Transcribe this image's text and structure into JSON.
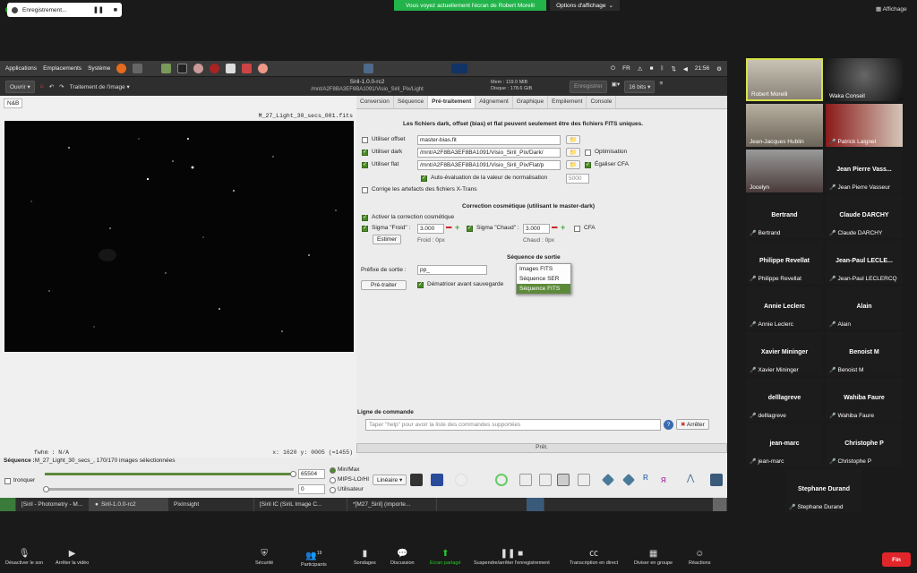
{
  "zoom_top": {
    "recording_label": "Enregistrement...",
    "share_banner": "Vous voyez actuellement l'écran de Robert Morelli",
    "view_options": "Options d'affichage",
    "display": "Affichage"
  },
  "desktop_bar": {
    "applications": "Applications",
    "places": "Emplacements",
    "system": "Système",
    "keyboard": "FR",
    "clock": "21:56"
  },
  "siril": {
    "open": "Ouvrir",
    "image_processing": "Traitement de l'image",
    "title": "Siril-1.0.0-rc2",
    "path": "/mnt/A2F8BA3EF8BA1091/Visio_Siril_Pix/Light",
    "mem": "Mem : 119.0 MiB",
    "disk": "Disque : 178.6 GiB",
    "record": "Enregistrer",
    "bits": "16 bits",
    "tab_nb": "N&B",
    "image_title": "M_27_Light_30_secs_001.fits",
    "fwhm": "fwhm : N/A",
    "coords": "x: 1620 y: 0005 (=1455)",
    "tabs": [
      "Conversion",
      "Séquence",
      "Pré-traitement",
      "Alignement",
      "Graphique",
      "Empilement",
      "Console"
    ],
    "info": "Les fichiers dark, offset (bias) et flat peuvent seulement être des fichiers FITS uniques.",
    "use_offset": "Utiliser offset",
    "offset_value": "master-bias.fit",
    "use_dark": "Utiliser dark",
    "dark_value": "/mnt/A2F8BA3EF8BA1091/Visio_Siril_Pix/Dark/",
    "optimisation": "Optimisation",
    "use_flat": "Utiliser flat",
    "flat_value": "/mnt/A2F8BA3EF8BA1091/Visio_Siril_Pix/Flat/p",
    "equalize_cfa": "Égaliser CFA",
    "auto_norm": "Auto-évaluation de la valeur de normalisation",
    "norm_value": "5000",
    "xtrans": "Corrige les artefacts des fichiers X-Trans",
    "cosmetic_header": "Correction cosmétique (utilisant le master-dark)",
    "activate_cosmetic": "Activer la correction cosmétique",
    "sigma_cold": "Sigma \"Froid\" :",
    "sigma_cold_value": "3.000",
    "sigma_hot": "Sigma \"Chaud\" :",
    "sigma_hot_value": "3.000",
    "cfa": "CFA",
    "estimate": "Estimer",
    "cold_px": "Froid : 0px",
    "hot_px": "Chaud : 0px",
    "output_header": "Séquence de sortie",
    "output_prefix_label": "Préfixe de sortie :",
    "output_prefix_value": "pp_",
    "preprocess": "Pré-traiter",
    "debayer": "Dématricer avant sauvegarde",
    "seq_options": [
      "Images FITS",
      "Séquence SER",
      "Séquence FITS"
    ],
    "cmd_label": "Ligne de commande",
    "cmd_placeholder": "Taper \"help\" pour avoir la liste des commandes supportées",
    "stop": "Arrêter",
    "progress": "Prêt.",
    "seq_status_label": "Séquence :",
    "seq_status": "M_27_Light_30_secs_, 170/170 images sélectionnées",
    "tronquer": "tronquer",
    "max_value": "65504",
    "min_value": "0",
    "radio_minmax": "Min/Max",
    "radio_mips": "MIPS-LO/HI",
    "radio_user": "Utilisateur",
    "scale": "Linéaire"
  },
  "taskbar": [
    "[Siril - Photometry - M...",
    "Siril-1.0.0-rc2",
    "PixInsight",
    "[Siril IC (SiriL Image C...",
    "*[M27_Siril] (importe..."
  ],
  "participants": [
    {
      "name": "Robert Morelli",
      "video": true
    },
    {
      "name": "Waka Conseil",
      "video": true
    },
    {
      "name": "Jean-Jacques Hublin",
      "video": true
    },
    {
      "name": "Patrick Laignel",
      "video": true
    },
    {
      "name": "Jocelyn",
      "video": true
    },
    {
      "name": "Jean Pierre Vasseur",
      "big": "Jean Pierre Vass..."
    },
    {
      "name": "Bertrand",
      "big": "Bertrand"
    },
    {
      "name": "Claude DARCHY",
      "big": "Claude DARCHY"
    },
    {
      "name": "Philippe Revellat",
      "big": "Philippe Revellat"
    },
    {
      "name": "Jean-Paul LECLERCQ",
      "big": "Jean-Paul LECLE..."
    },
    {
      "name": "Annie Leclerc",
      "big": "Annie Leclerc"
    },
    {
      "name": "Alain",
      "big": "Alain"
    },
    {
      "name": "Xavier Mininger",
      "big": "Xavier Mininger"
    },
    {
      "name": "Benoist M",
      "big": "Benoist M"
    },
    {
      "name": "delllagreve",
      "big": "delllagreve"
    },
    {
      "name": "Wahiba Faure",
      "big": "Wahiba Faure"
    },
    {
      "name": "jean-marc",
      "big": "jean-marc"
    },
    {
      "name": "Christophe P",
      "big": "Christophe P"
    },
    {
      "name": "Stephane Durand",
      "big": "Stephane Durand"
    }
  ],
  "zoom_bottom": {
    "mute": "Désactiver le son",
    "video": "Arrêter la vidéo",
    "security": "Sécurité",
    "participants": "Participants",
    "participant_count": "19",
    "polls": "Sondages",
    "chat": "Discussion",
    "share": "Écran partagé",
    "record": "Suspendre/arrêter l'enregistrement",
    "live": "Transcription en direct",
    "breakout": "Diviser en groupe",
    "reactions": "Réactions",
    "end": "Fin"
  }
}
